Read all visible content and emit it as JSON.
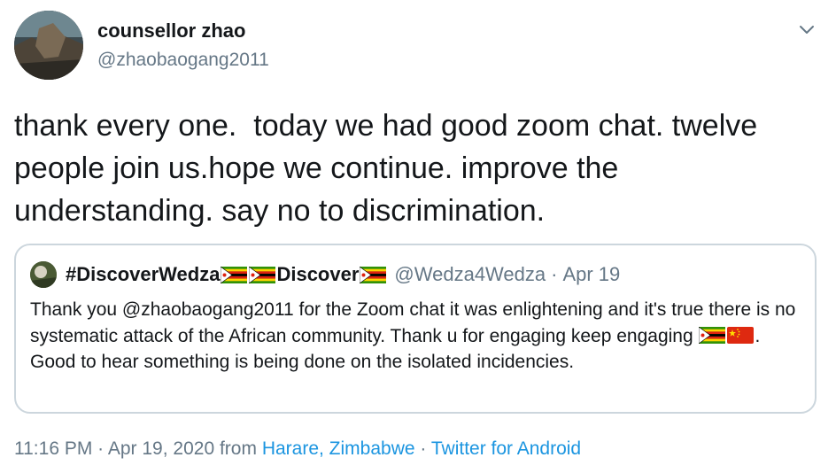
{
  "author": {
    "name": "counsellor zhao",
    "handle": "@zhaobaogang2011"
  },
  "tweet": {
    "text": "thank every one.  today we had good zoom chat. twelve people join us.hope we continue. improve the understanding. say no to discrimination."
  },
  "quoted_tweet": {
    "name_part1": "#DiscoverWedza",
    "name_part2": "Discover",
    "handle": "@Wedza4Wedza",
    "separator": "·",
    "date": "Apr 19",
    "text_part1": "Thank you @zhaobaogang2011 for the Zoom chat it was enlightening  and it's true there is no systematic attack of the African community. Thank u for engaging keep engaging ",
    "text_part2": ". Good to hear something is being done on the isolated incidencies."
  },
  "footer": {
    "time": "11:16 PM",
    "sep1": "·",
    "date": "Apr 19, 2020",
    "from": "from",
    "location": "Harare, Zimbabwe",
    "sep2": "·",
    "source": "Twitter for Android"
  },
  "colors": {
    "text": "#14171a",
    "secondary": "#657786",
    "link": "#1b95e0",
    "border": "#ccd6dd"
  },
  "icons": {
    "caret": "chevron-down-icon",
    "flag_zimbabwe": "flag-zimbabwe-icon",
    "flag_china": "flag-china-icon"
  }
}
